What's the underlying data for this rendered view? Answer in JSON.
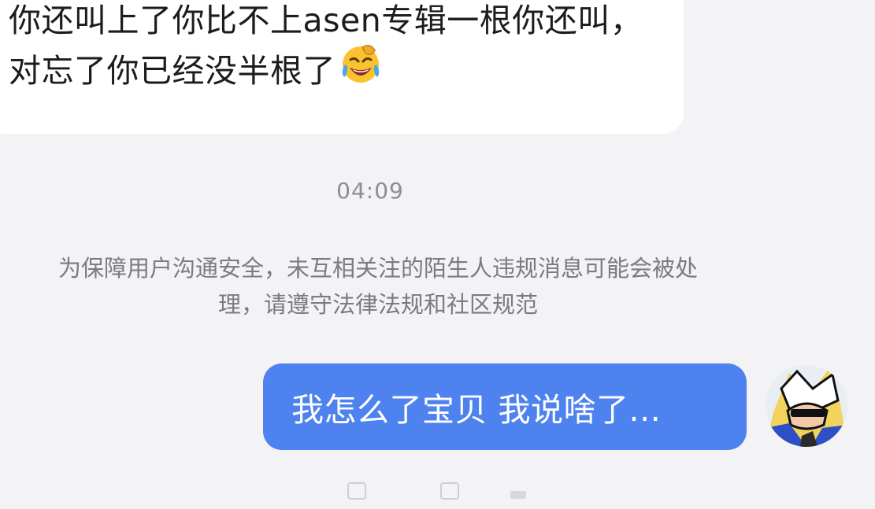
{
  "chat": {
    "incoming_message": "你还叫上了你比不上asen专辑一根你还叫，对忘了你已经没半根了",
    "incoming_emoji": "rolling-on-floor-laughing-emoji",
    "timestamp": "04:09",
    "system_notice_line1": "为保障用户沟通安全，未互相关注的陌生人违规消息可能会被处",
    "system_notice_line2": "理，请遵守法律法规和社区规范",
    "outgoing_message": "我怎么了宝贝 我说啥了..."
  },
  "colors": {
    "background": "#f3f3f5",
    "incoming_bubble": "#ffffff",
    "outgoing_bubble": "#4e82ee",
    "notice_text": "#7b7b80"
  }
}
